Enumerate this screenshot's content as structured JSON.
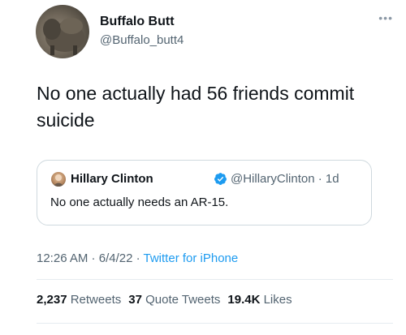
{
  "author": {
    "display_name": "Buffalo Butt",
    "handle": "@Buffalo_butt4"
  },
  "tweet_text": "No one actually had 56 friends commit suicide",
  "quoted_tweet": {
    "display_name": "Hillary Clinton",
    "handle_time": "@HillaryClinton · 1d",
    "text": "No one actually needs an AR-15."
  },
  "meta": {
    "time": "12:26 AM",
    "sep1": " · ",
    "date": "6/4/22",
    "sep2": " · ",
    "source": "Twitter for iPhone"
  },
  "stats": {
    "retweets_count": "2,237",
    "retweets_label": "Retweets",
    "quotes_count": "37",
    "quotes_label": "Quote Tweets",
    "likes_count": "19.4K",
    "likes_label": "Likes"
  },
  "icons": {
    "more": "more-icon",
    "verified": "verified-badge-icon"
  },
  "colors": {
    "link_blue": "#1d9bf0",
    "secondary_text": "#536471",
    "primary_text": "#0f1419",
    "border": "#cfd9de"
  }
}
